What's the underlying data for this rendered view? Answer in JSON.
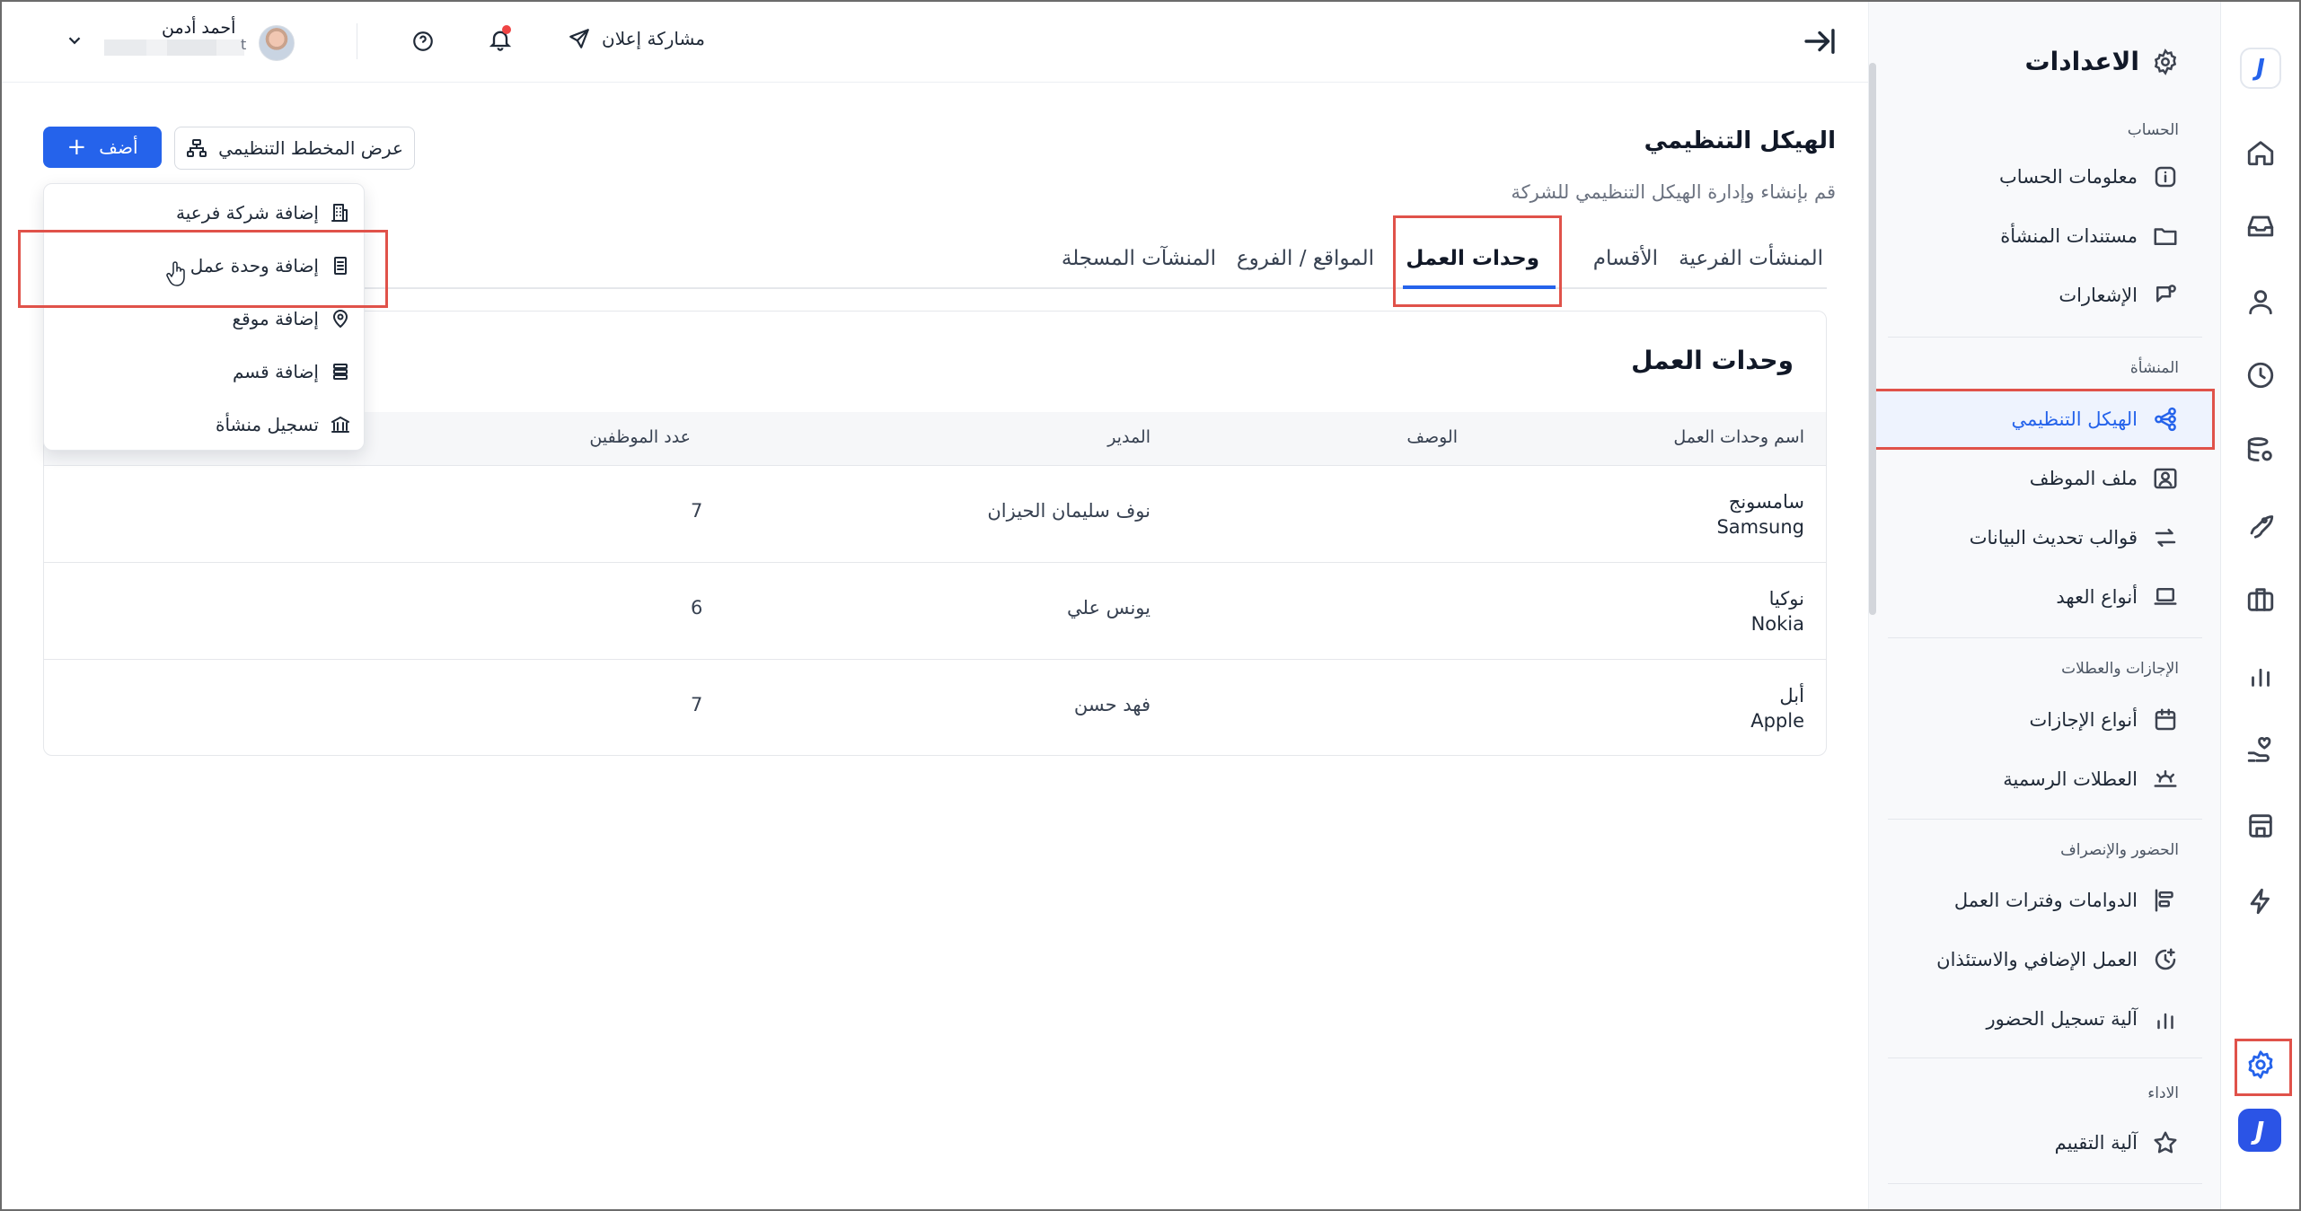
{
  "header": {
    "share_label": "مشاركة إعلان",
    "user_name": "أحمد أدمن",
    "user_sub_tail": "t"
  },
  "settings": {
    "title": "الاعدادات",
    "groups": [
      {
        "label": "الحساب",
        "items": [
          {
            "label": "معلومات الحساب",
            "icon": "info-icon"
          },
          {
            "label": "مستندات المنشأة",
            "icon": "folder-icon"
          },
          {
            "label": "الإشعارات",
            "icon": "notification-icon"
          }
        ]
      },
      {
        "label": "المنشأة",
        "items": [
          {
            "label": "الهيكل التنظيمي",
            "icon": "hierarchy-icon",
            "active": true
          },
          {
            "label": "ملف الموظف",
            "icon": "employee-file-icon"
          },
          {
            "label": "قوالب تحديث البيانات",
            "icon": "swap-arrows-icon"
          },
          {
            "label": "أنواع العهد",
            "icon": "laptop-icon"
          }
        ]
      },
      {
        "label": "الإجازات والعطلات",
        "items": [
          {
            "label": "أنواع الإجازات",
            "icon": "calendar-icon"
          },
          {
            "label": "العطلات الرسمية",
            "icon": "sun-horizon-icon"
          }
        ]
      },
      {
        "label": "الحضور والإنصراف",
        "items": [
          {
            "label": "الدوامات وفترات العمل",
            "icon": "shifts-icon"
          },
          {
            "label": "العمل الإضافي والاستئذان",
            "icon": "clock-plus-icon"
          },
          {
            "label": "آلية تسجيل الحضور",
            "icon": "bar-chart-icon"
          }
        ]
      },
      {
        "label": "الاداء",
        "items": [
          {
            "label": "آلية التقييم",
            "icon": "star-icon"
          }
        ]
      }
    ]
  },
  "rail": {
    "logo_letter": "J",
    "icons": [
      "home-icon",
      "inbox-icon",
      "user-icon",
      "clock-icon",
      "database-users-icon",
      "rocket-icon",
      "briefcase-icon",
      "chart-icon",
      "hand-heart-icon",
      "store-icon",
      "lightning-icon",
      "settings-icon"
    ],
    "active": "settings-icon"
  },
  "main": {
    "title": "الهيكل التنظيمي",
    "description": "قم بإنشاء وإدارة الهيكل التنظيمي للشركة",
    "add_button": "أضف",
    "org_chart_button": "عرض المخطط التنظيمي",
    "tabs": [
      {
        "label": "المنشأت الفرعية"
      },
      {
        "label": "الأقسام"
      },
      {
        "label": "وحدات العمل",
        "active": true
      },
      {
        "label": "المواقع / الفروع"
      },
      {
        "label": "المنشآت المسجلة"
      }
    ],
    "card_title": "وحدات العمل",
    "columns": [
      "اسم وحدات العمل",
      "الوصف",
      "المدير",
      "عدد الموظفين"
    ],
    "rows": [
      {
        "name_ar": "سامسونج",
        "name_en": "Samsung",
        "description": "",
        "manager": "نوف سليمان الحيزان",
        "employees": "7"
      },
      {
        "name_ar": "نوكيا",
        "name_en": "Nokia",
        "description": "",
        "manager": "يونس علي",
        "employees": "6"
      },
      {
        "name_ar": "أبل",
        "name_en": "Apple",
        "description": "",
        "manager": "فهد حسن",
        "employees": "7"
      }
    ]
  },
  "dropdown": {
    "items": [
      {
        "label": "إضافة شركة فرعية",
        "icon": "building-icon"
      },
      {
        "label": "إضافة وحدة عمل",
        "icon": "document-icon",
        "highlighted": true
      },
      {
        "label": "إضافة موقع",
        "icon": "map-pin-icon"
      },
      {
        "label": "إضافة قسم",
        "icon": "layers-icon"
      },
      {
        "label": "تسجيل منشأة",
        "icon": "bank-icon"
      }
    ]
  }
}
